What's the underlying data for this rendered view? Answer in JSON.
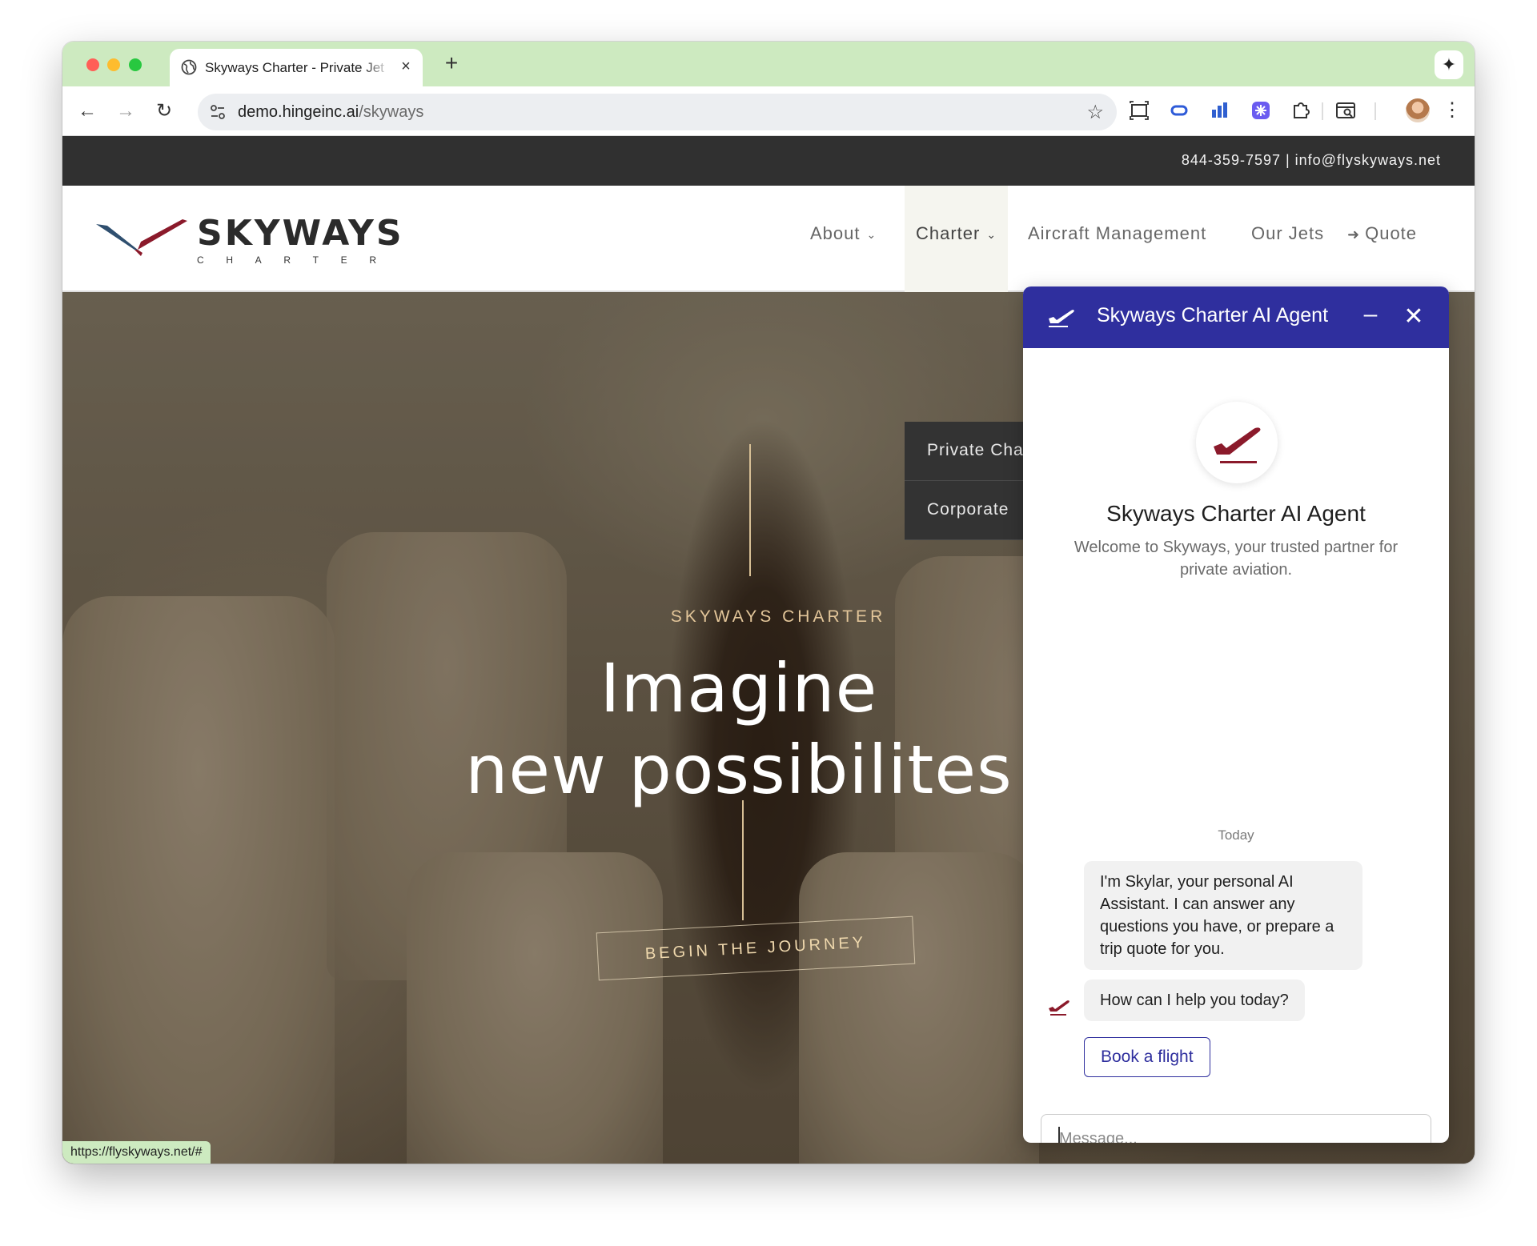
{
  "browser": {
    "tab_title": "Skyways Charter - Private Jet",
    "url_host": "demo.hingeinc.ai",
    "url_path": "/skyways",
    "status_url": "https://flyskyways.net/#"
  },
  "site": {
    "contact": "844-359-7597 | info@flyskyways.net",
    "logo_word": "SKYWAYS",
    "logo_sub": [
      "C",
      "H",
      "A",
      "R",
      "T",
      "E",
      "R"
    ],
    "nav": [
      {
        "label": "About"
      },
      {
        "label": "Charter"
      },
      {
        "label": "Aircraft Management"
      },
      {
        "label": "Our Jets"
      },
      {
        "label": "Quote"
      }
    ],
    "dropdown": [
      "Private Charter",
      "Corporate"
    ],
    "hero": {
      "eyebrow": "SKYWAYS CHARTER",
      "headline_line1": "Imagine",
      "headline_line2": "new possibilites",
      "cta": "BEGIN THE JOURNEY"
    }
  },
  "chat": {
    "header_title": "Skyways Charter AI Agent",
    "title": "Skyways Charter AI Agent",
    "welcome": "Welcome to Skyways, your trusted partner for private aviation.",
    "date": "Today",
    "messages": [
      "I'm Skylar, your personal AI Assistant. I can answer any questions you have, or prepare a trip quote for you.",
      "How can I help you today?"
    ],
    "quick_reply": "Book a flight",
    "input_placeholder": "Message..."
  },
  "colors": {
    "brand_blue": "#2f2f9e",
    "brand_red": "#8b1a2b",
    "tab_strip": "#cdeac0",
    "topbar": "#303030",
    "hero_accent": "#e3c69a"
  },
  "icons": {
    "back": "arrow-left-icon",
    "forward": "arrow-right-icon",
    "reload": "reload-icon",
    "bookmark": "star-icon",
    "chat_header": "plane-takeoff-icon",
    "minimize": "minimize-icon",
    "close": "close-icon"
  }
}
